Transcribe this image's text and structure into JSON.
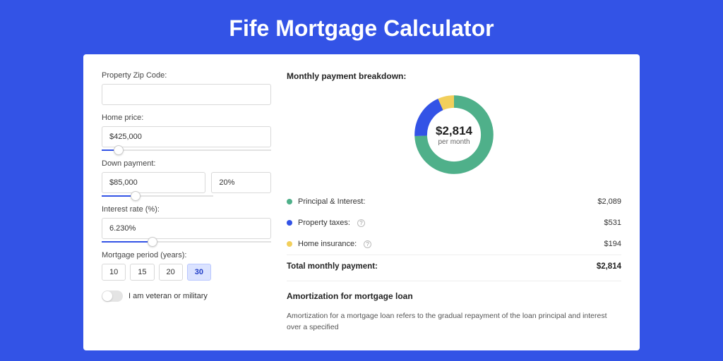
{
  "page": {
    "title": "Fife Mortgage Calculator"
  },
  "form": {
    "zip": {
      "label": "Property Zip Code:",
      "value": ""
    },
    "home_price": {
      "label": "Home price:",
      "value": "$425,000",
      "slider_pct": 10
    },
    "down_payment": {
      "label": "Down payment:",
      "amount": "$85,000",
      "percent": "20%",
      "slider_pct": 20
    },
    "interest": {
      "label": "Interest rate (%):",
      "value": "6.230%",
      "slider_pct": 30
    },
    "period": {
      "label": "Mortgage period (years):",
      "options": [
        "10",
        "15",
        "20",
        "30"
      ],
      "active": "30"
    },
    "veteran": {
      "label": "I am veteran or military",
      "on": false
    }
  },
  "breakdown": {
    "heading": "Monthly payment breakdown:",
    "center_value": "$2,814",
    "center_sub": "per month",
    "items": [
      {
        "label": "Principal & Interest:",
        "value": "$2,089",
        "color": "green",
        "help": false
      },
      {
        "label": "Property taxes:",
        "value": "$531",
        "color": "blue",
        "help": true
      },
      {
        "label": "Home insurance:",
        "value": "$194",
        "color": "yellow",
        "help": true
      }
    ],
    "total_label": "Total monthly payment:",
    "total_value": "$2,814"
  },
  "chart_data": {
    "type": "pie",
    "title": "Monthly payment breakdown",
    "series": [
      {
        "name": "Principal & Interest",
        "value": 2089,
        "color": "#4fb08a"
      },
      {
        "name": "Property taxes",
        "value": 531,
        "color": "#3353e6"
      },
      {
        "name": "Home insurance",
        "value": 194,
        "color": "#f2cf5b"
      }
    ],
    "total": 2814
  },
  "amortization": {
    "heading": "Amortization for mortgage loan",
    "text": "Amortization for a mortgage loan refers to the gradual repayment of the loan principal and interest over a specified"
  }
}
